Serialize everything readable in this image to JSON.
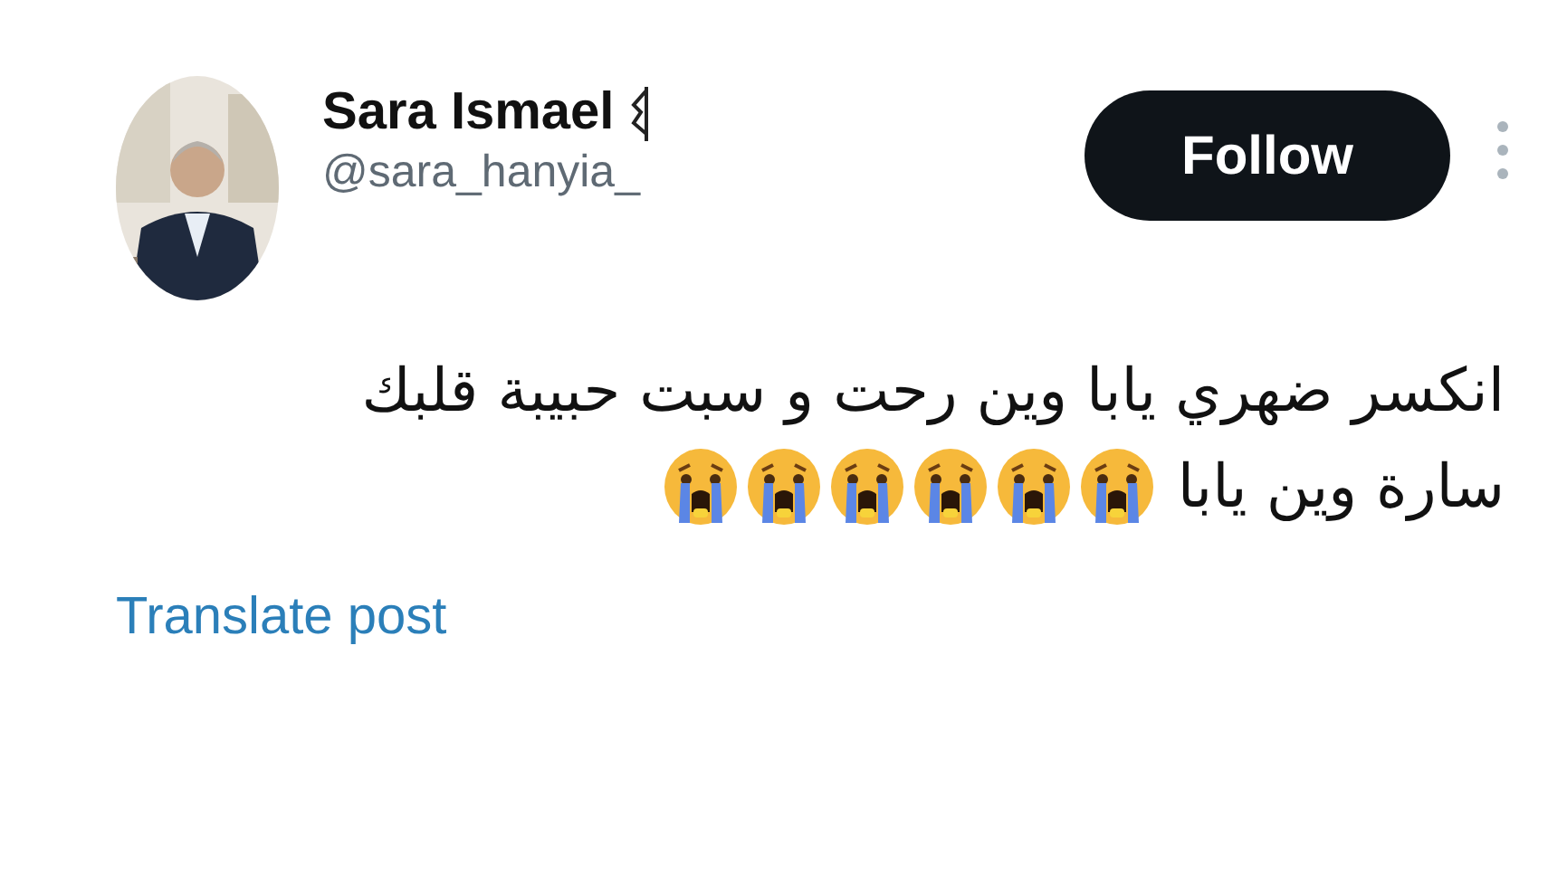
{
  "post": {
    "author": {
      "name": "Sara Ismael",
      "handle": "@sara_hanyia_"
    },
    "follow_button": {
      "label": "Follow"
    },
    "text_lines": [
      "انكسر ضهري يابا وين رحت و سبت حبيبة قلبك",
      "سارة وين يابا"
    ],
    "emojis": [
      {
        "kind": "loudly-crying"
      },
      {
        "kind": "loudly-crying"
      },
      {
        "kind": "loudly-crying"
      },
      {
        "kind": "loudly-crying"
      },
      {
        "kind": "loudly-crying"
      },
      {
        "kind": "loudly-crying"
      }
    ],
    "translate_link": "Translate post"
  }
}
